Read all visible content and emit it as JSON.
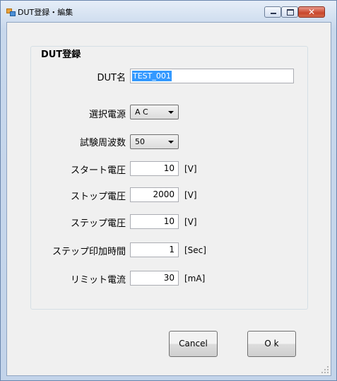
{
  "window": {
    "title": "DUT登録・編集"
  },
  "form": {
    "group_title": "DUT登録",
    "dut_name": {
      "label": "DUT名",
      "value": "TEST_001"
    },
    "power_source": {
      "label": "選択電源",
      "value": "A C"
    },
    "test_frequency": {
      "label": "試験周波数",
      "value": "50"
    },
    "start_voltage": {
      "label": "スタート電圧",
      "value": "10",
      "unit": "[V]"
    },
    "stop_voltage": {
      "label": "ストップ電圧",
      "value": "2000",
      "unit": "[V]"
    },
    "step_voltage": {
      "label": "ステップ電圧",
      "value": "10",
      "unit": "[V]"
    },
    "step_apply_time": {
      "label": "ステップ印加時間",
      "value": "1",
      "unit": "[Sec]"
    },
    "limit_current": {
      "label": "リミット電流",
      "value": "30",
      "unit": "[mA]"
    }
  },
  "buttons": {
    "cancel": "Cancel",
    "ok": "O k"
  },
  "colors": {
    "selection": "#3399ff",
    "window_background": "#f0f0f0",
    "close_button": "#c9462b"
  },
  "icons": {
    "app": "app-icon",
    "minimize": "minimize-icon",
    "maximize": "maximize-icon",
    "close": "close-icon"
  }
}
